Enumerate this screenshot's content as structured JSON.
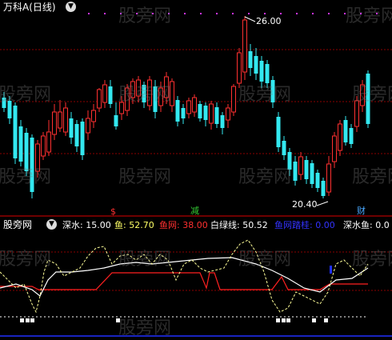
{
  "upper_panel": {
    "title": "万科A(日线)",
    "collapse_icon": "chevron-down-icon",
    "high_label": "26.00",
    "low_label": "20.40",
    "signals": [
      {
        "text": "$",
        "color": "#ff3030"
      },
      {
        "text": "减",
        "color": "#33cc33"
      },
      {
        "text": "财",
        "color": "#4aa8ff"
      }
    ]
  },
  "lower_panel": {
    "title": "股旁网",
    "collapse_icon": "chevron-down-icon",
    "legend": [
      {
        "label": "深水: 15.00",
        "color": "#ffffff"
      },
      {
        "label": "鱼: 52.70",
        "color": "#ffff66"
      },
      {
        "label": "鱼网: 38.00",
        "color": "#ff3030"
      },
      {
        "label": "白绿线: 50.52",
        "color": "#ffffff"
      },
      {
        "label": "鱼网踏桂: 0.00",
        "color": "#3333ff"
      },
      {
        "label": "深水鱼: 0.0",
        "color": "#ffffff"
      }
    ]
  },
  "watermark": "股旁网",
  "colors": {
    "up": "#ff3030",
    "down": "#33e8f0",
    "grid": "#8a0000",
    "fishnet": "#ff2020",
    "white_green_line": "#ffffff",
    "fish_line": "#ffff66"
  },
  "chart_data": {
    "type": "candlestick",
    "price_high": 26.0,
    "price_low": 20.4,
    "indicator_ylim": [
      0,
      100
    ]
  }
}
